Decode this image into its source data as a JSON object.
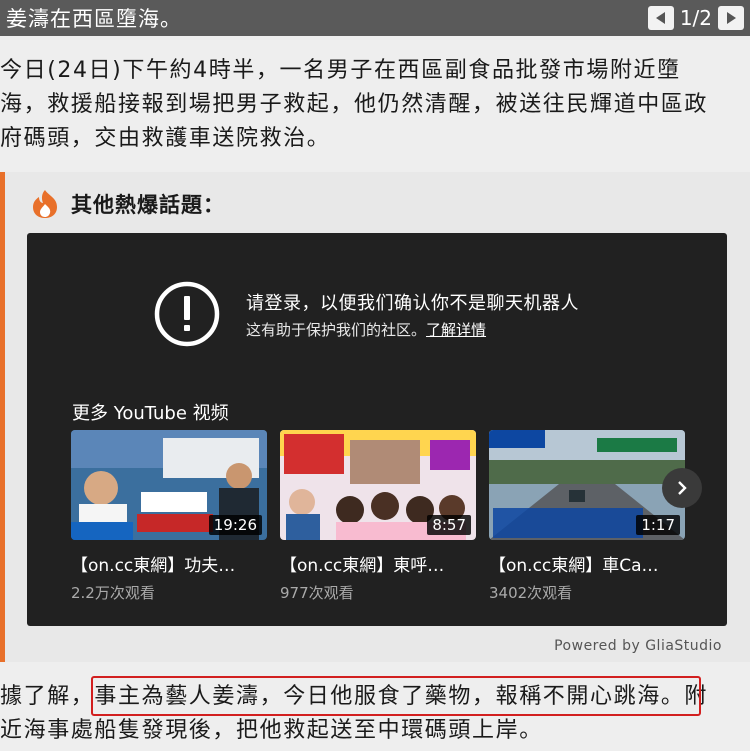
{
  "header": {
    "title": "姜濤在西區墮海。",
    "page_indicator": "1/2",
    "prev_icon": "triangle-left-icon",
    "next_icon": "triangle-right-icon"
  },
  "article": {
    "para1_lines": [
      "今日(24日)下午約4時半，一名男子在西區副食品批發市場附近墮",
      "海，救援船接報到場把男子救起，他仍然清醒，被送往民輝道中區政",
      "府碼頭，交由救護車送院救治。"
    ],
    "para2_prefix": "據了解，",
    "para2_highlight": "事主為藝人姜濤，今日他服食了藥物，報稱不開心跳海",
    "para2_suffix": "。附",
    "para3": "近海事處船隻發現後，把他救起送至中環碼頭上岸。"
  },
  "topics": {
    "title": "其他熱爆話題：",
    "icon": "flame-icon",
    "accent_color": "#e8702a"
  },
  "player": {
    "notice": "请登录，以便我们确认你不是聊天机器人",
    "notice_sub": "这有助于保护我们的社区。",
    "learn_more": "了解详情",
    "more_label": "更多 YouTube 视频",
    "videos": [
      {
        "title": "【on.cc東網】功夫…",
        "views": "2.2万次观看",
        "duration": "19:26"
      },
      {
        "title": "【on.cc東網】東呼…",
        "views": "977次观看",
        "duration": "8:57"
      },
      {
        "title": "【on.cc東網】車Ca…",
        "views": "3402次观看",
        "duration": "1:17"
      }
    ],
    "powered_by": "Powered by GliaStudio"
  }
}
